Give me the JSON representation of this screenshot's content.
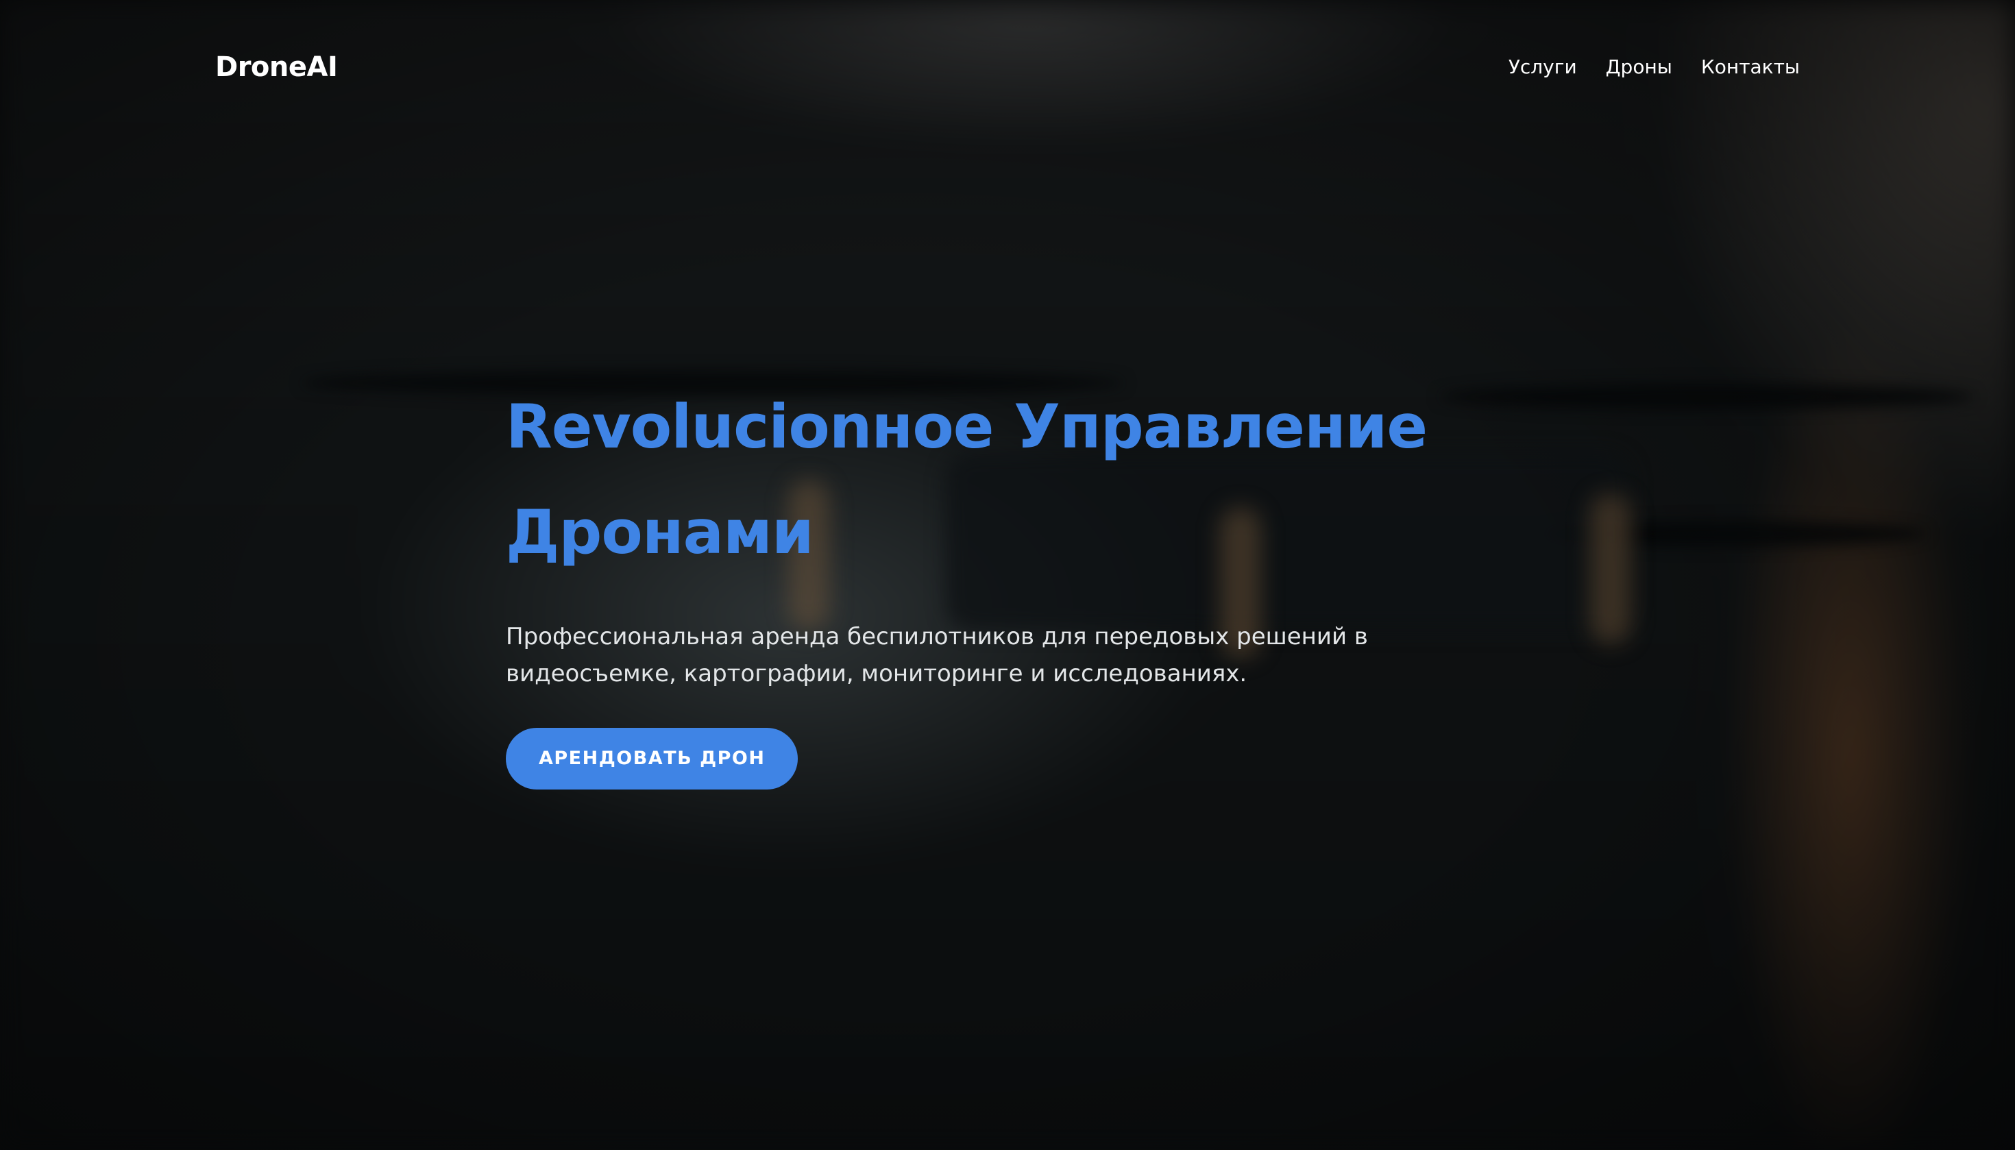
{
  "header": {
    "logo": "DroneAI",
    "nav": [
      {
        "label": "Услуги"
      },
      {
        "label": "Дроны"
      },
      {
        "label": "Контакты"
      }
    ]
  },
  "hero": {
    "title": "Revolucionное Управление Дронами",
    "subtitle": "Профессиональная аренда беспилотников для передовых решений в видеосъемке, картографии, мониторинге и исследованиях.",
    "cta_label": "АРЕНДОВАТЬ ДРОН"
  },
  "colors": {
    "accent": "#3f84e5",
    "text_light": "#ffffff",
    "background": "#0b0d0e"
  }
}
